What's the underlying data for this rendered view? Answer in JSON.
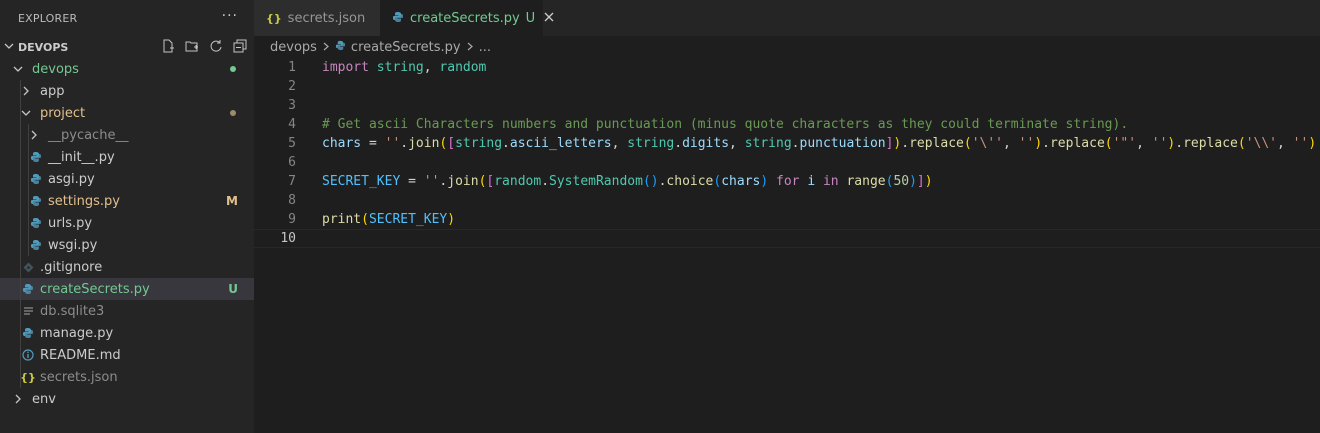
{
  "explorer": {
    "title": "EXPLORER",
    "more": "···",
    "section_title": "DEVOPS",
    "items": [
      {
        "label": "devops",
        "status": "dot"
      },
      {
        "label": "app"
      },
      {
        "label": "project",
        "status": "dot"
      },
      {
        "label": "__pycache__"
      },
      {
        "label": "__init__.py"
      },
      {
        "label": "asgi.py"
      },
      {
        "label": "settings.py",
        "badge": "M"
      },
      {
        "label": "urls.py"
      },
      {
        "label": "wsgi.py"
      },
      {
        "label": ".gitignore"
      },
      {
        "label": "createSecrets.py",
        "badge": "U"
      },
      {
        "label": "db.sqlite3"
      },
      {
        "label": "manage.py"
      },
      {
        "label": "README.md"
      },
      {
        "label": "secrets.json"
      },
      {
        "label": "env"
      }
    ]
  },
  "tabs": [
    {
      "label": "secrets.json",
      "icon": "json-icon"
    },
    {
      "label": "createSecrets.py",
      "icon": "python-icon",
      "status": "U"
    }
  ],
  "breadcrumb": {
    "root": "devops",
    "file": "createSecrets.py",
    "more": "..."
  },
  "line_numbers": [
    "1",
    "2",
    "3",
    "4",
    "5",
    "6",
    "7",
    "8",
    "9",
    "10"
  ],
  "code": {
    "l1": [
      "import",
      " ",
      "string",
      ", ",
      "random"
    ],
    "l4": "# Get ascii Characters numbers and punctuation (minus quote characters as they could terminate string).",
    "l5": [
      "chars",
      " = ",
      "''",
      ".",
      "join",
      "(",
      "[",
      "string",
      ".",
      "ascii_letters",
      ", ",
      "string",
      ".",
      "digits",
      ", ",
      "string",
      ".",
      "punctuation",
      "]",
      ")",
      ".",
      "replace",
      "(",
      "'\\''",
      ", ",
      "''",
      ")",
      ".",
      "replace",
      "(",
      "'\"'",
      ", ",
      "''",
      ")",
      ".",
      "replace",
      "(",
      "'\\\\'",
      ", ",
      "''",
      ")"
    ],
    "l7": [
      "SECRET_KEY",
      " = ",
      "''",
      ".",
      "join",
      "(",
      "[",
      "random",
      ".",
      "SystemRandom",
      "(",
      ")",
      ".",
      "choice",
      "(",
      "chars",
      ")",
      " ",
      "for",
      " ",
      "i",
      " ",
      "in",
      " ",
      "range",
      "(",
      "50",
      ")",
      "]",
      ")"
    ],
    "l9": [
      "print",
      "(",
      "SECRET_KEY",
      ")"
    ]
  },
  "colors": {
    "accent_green": "#73c991",
    "modified": "#e2c08d",
    "python_icon": "#519aba",
    "json_icon": "#cbcb41"
  }
}
